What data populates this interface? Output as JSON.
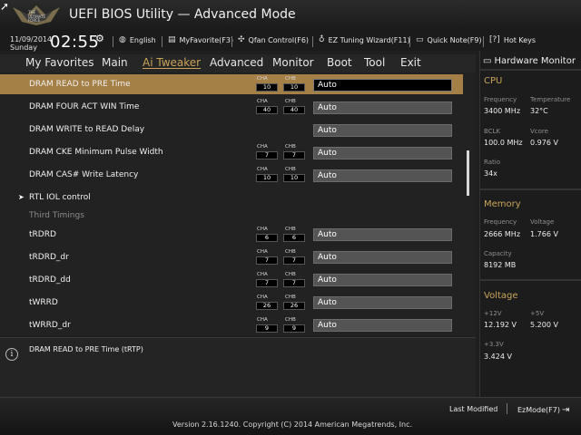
{
  "window": {
    "title": "UEFI BIOS Utility — Advanced Mode",
    "logo_text": [
      "THE",
      "ULTIMATE",
      "FORCE"
    ]
  },
  "status": {
    "date": "11/09/2014",
    "day": "Sunday",
    "time": "02:55",
    "items": [
      {
        "icon": "globe-icon",
        "label": "English"
      },
      {
        "icon": "favorite-icon",
        "label": "MyFavorite(F3)"
      },
      {
        "icon": "fan-icon",
        "label": "Qfan Control(F6)"
      },
      {
        "icon": "lightbulb-icon",
        "label": "EZ Tuning Wizard(F11)"
      },
      {
        "icon": "note-icon",
        "label": "Quick Note(F9)"
      },
      {
        "icon": "help-icon",
        "label": "Hot Keys"
      }
    ]
  },
  "menu": [
    {
      "label": "My Favorites",
      "active": false
    },
    {
      "label": "Main",
      "active": false
    },
    {
      "label": "Ai Tweaker",
      "active": true
    },
    {
      "label": "Advanced",
      "active": false
    },
    {
      "label": "Monitor",
      "active": false
    },
    {
      "label": "Boot",
      "active": false
    },
    {
      "label": "Tool",
      "active": false
    },
    {
      "label": "Exit",
      "active": false
    }
  ],
  "channel_labels": {
    "a": "CHA",
    "b": "CHB"
  },
  "rows": [
    {
      "label": "DRAM READ to PRE Time",
      "cha": "10",
      "chb": "10",
      "value": "Auto",
      "selected": true
    },
    {
      "label": "DRAM FOUR ACT WIN Time",
      "cha": "40",
      "chb": "40",
      "value": "Auto"
    },
    {
      "label": "DRAM WRITE to READ Delay",
      "cha": "",
      "chb": "",
      "value": "Auto"
    },
    {
      "label": "DRAM CKE Minimum Pulse Width",
      "cha": "7",
      "chb": "7",
      "value": "Auto"
    },
    {
      "label": "DRAM CAS# Write Latency",
      "cha": "10",
      "chb": "10",
      "value": "Auto"
    },
    {
      "label": "RTL IOL control",
      "submenu": true
    },
    {
      "label": "Third Timings",
      "header": true
    },
    {
      "label": "tRDRD",
      "cha": "6",
      "chb": "6",
      "value": "Auto"
    },
    {
      "label": "tRDRD_dr",
      "cha": "7",
      "chb": "7",
      "value": "Auto"
    },
    {
      "label": "tRDRD_dd",
      "cha": "7",
      "chb": "7",
      "value": "Auto"
    },
    {
      "label": "tWRRD",
      "cha": "26",
      "chb": "26",
      "value": "Auto"
    },
    {
      "label": "tWRRD_dr",
      "cha": "9",
      "chb": "9",
      "value": "Auto"
    }
  ],
  "help_text": "DRAM READ to PRE Time (tRTP)",
  "hardware_monitor": {
    "title": "Hardware Monitor",
    "cpu": {
      "section": "CPU",
      "frequency_label": "Frequency",
      "frequency": "3400 MHz",
      "temperature_label": "Temperature",
      "temperature": "32°C",
      "bclk_label": "BCLK",
      "bclk": "100.0 MHz",
      "vcore_label": "Vcore",
      "vcore": "0.976 V",
      "ratio_label": "Ratio",
      "ratio": "34x"
    },
    "memory": {
      "section": "Memory",
      "frequency_label": "Frequency",
      "frequency": "2666 MHz",
      "voltage_label": "Voltage",
      "voltage": "1.766 V",
      "capacity_label": "Capacity",
      "capacity": "8192 MB"
    },
    "voltage": {
      "section": "Voltage",
      "v12_label": "+12V",
      "v12": "12.192 V",
      "v5_label": "+5V",
      "v5": "5.200 V",
      "v33_label": "+3.3V",
      "v33": "3.424 V"
    }
  },
  "footer": {
    "last_modified": "Last Modified",
    "ez_mode": "EzMode(F7)",
    "version": "Version 2.16.1240. Copyright (C) 2014 American Megatrends, Inc."
  },
  "colors": {
    "accent": "#c9a45a",
    "selected_row": "#a47f46"
  }
}
